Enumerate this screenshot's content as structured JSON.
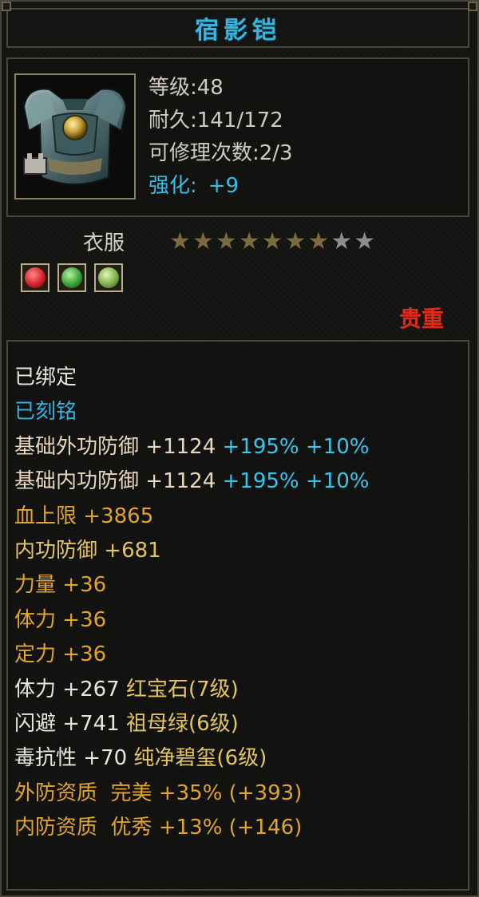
{
  "title": "宿影铠",
  "item": {
    "icon": "chest-armor-icon",
    "lines": [
      "等级:48",
      "耐久:141/172",
      "可修理次数:2/3"
    ],
    "enhance_label": "强化:",
    "enhance_value": "+9"
  },
  "type_label": "衣服",
  "stars": {
    "filled": 7,
    "total": 9
  },
  "gems": [
    {
      "icon": "red-gem-icon",
      "color": "#d3202a"
    },
    {
      "icon": "green-gem-icon",
      "color": "#39a23a"
    },
    {
      "icon": "jade-gem-icon",
      "color": "#7cae4a"
    }
  ],
  "rarity": "贵重",
  "attributes": {
    "bound": "已绑定",
    "engraved": "已刻铭",
    "outer_def": {
      "label": "基础外功防御",
      "base": "+1124",
      "pct": "+195%",
      "bonus": "+10%"
    },
    "inner_def": {
      "label": "基础内功防御",
      "base": "+1124",
      "pct": "+195%",
      "bonus": "+10%"
    },
    "hp": {
      "label": "血上限",
      "value": "+3865"
    },
    "inner_defense": {
      "label": "内功防御",
      "value": "+681"
    },
    "strength": {
      "label": "力量",
      "value": "+36"
    },
    "stamina": {
      "label": "体力",
      "value": "+36"
    },
    "focus": {
      "label": "定力",
      "value": "+36"
    },
    "gem1": {
      "label": "体力",
      "value": "+267",
      "gem": "红宝石(7级)"
    },
    "gem2": {
      "label": "闪避",
      "value": "+741",
      "gem": "祖母绿(6级)"
    },
    "gem3": {
      "label": "毒抗性",
      "value": "+70",
      "gem": "纯净碧玺(6级)"
    },
    "outer_quality": {
      "label": "外防资质",
      "grade": "完美",
      "pct": "+35%",
      "paren": "(+393)"
    },
    "inner_quality": {
      "label": "内防资质",
      "grade": "优秀",
      "pct": "+13%",
      "paren": "(+146)"
    }
  }
}
